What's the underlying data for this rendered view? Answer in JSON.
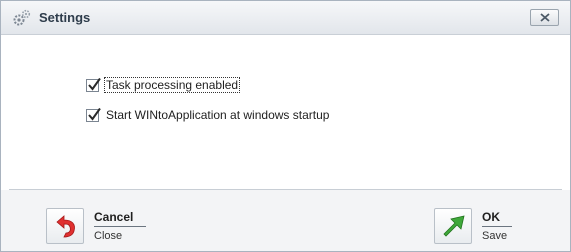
{
  "window": {
    "title": "Settings"
  },
  "options": [
    {
      "label": "Task processing enabled",
      "checked": true
    },
    {
      "label": "Start WINtoApplication at windows startup",
      "checked": true
    }
  ],
  "actions": {
    "cancel": {
      "title": "Cancel",
      "subtitle": "Close"
    },
    "ok": {
      "title": "OK",
      "subtitle": "Save"
    }
  },
  "colors": {
    "cancel_arrow": "#e03030",
    "ok_arrow": "#3fa83a",
    "title_text": "#2f3d4c"
  },
  "icons": {
    "title": "settings-gears-icon",
    "close": "close-icon",
    "cancel": "undo-arrow-icon",
    "ok": "confirm-arrow-icon",
    "checkbox": "checkmark-icon"
  }
}
